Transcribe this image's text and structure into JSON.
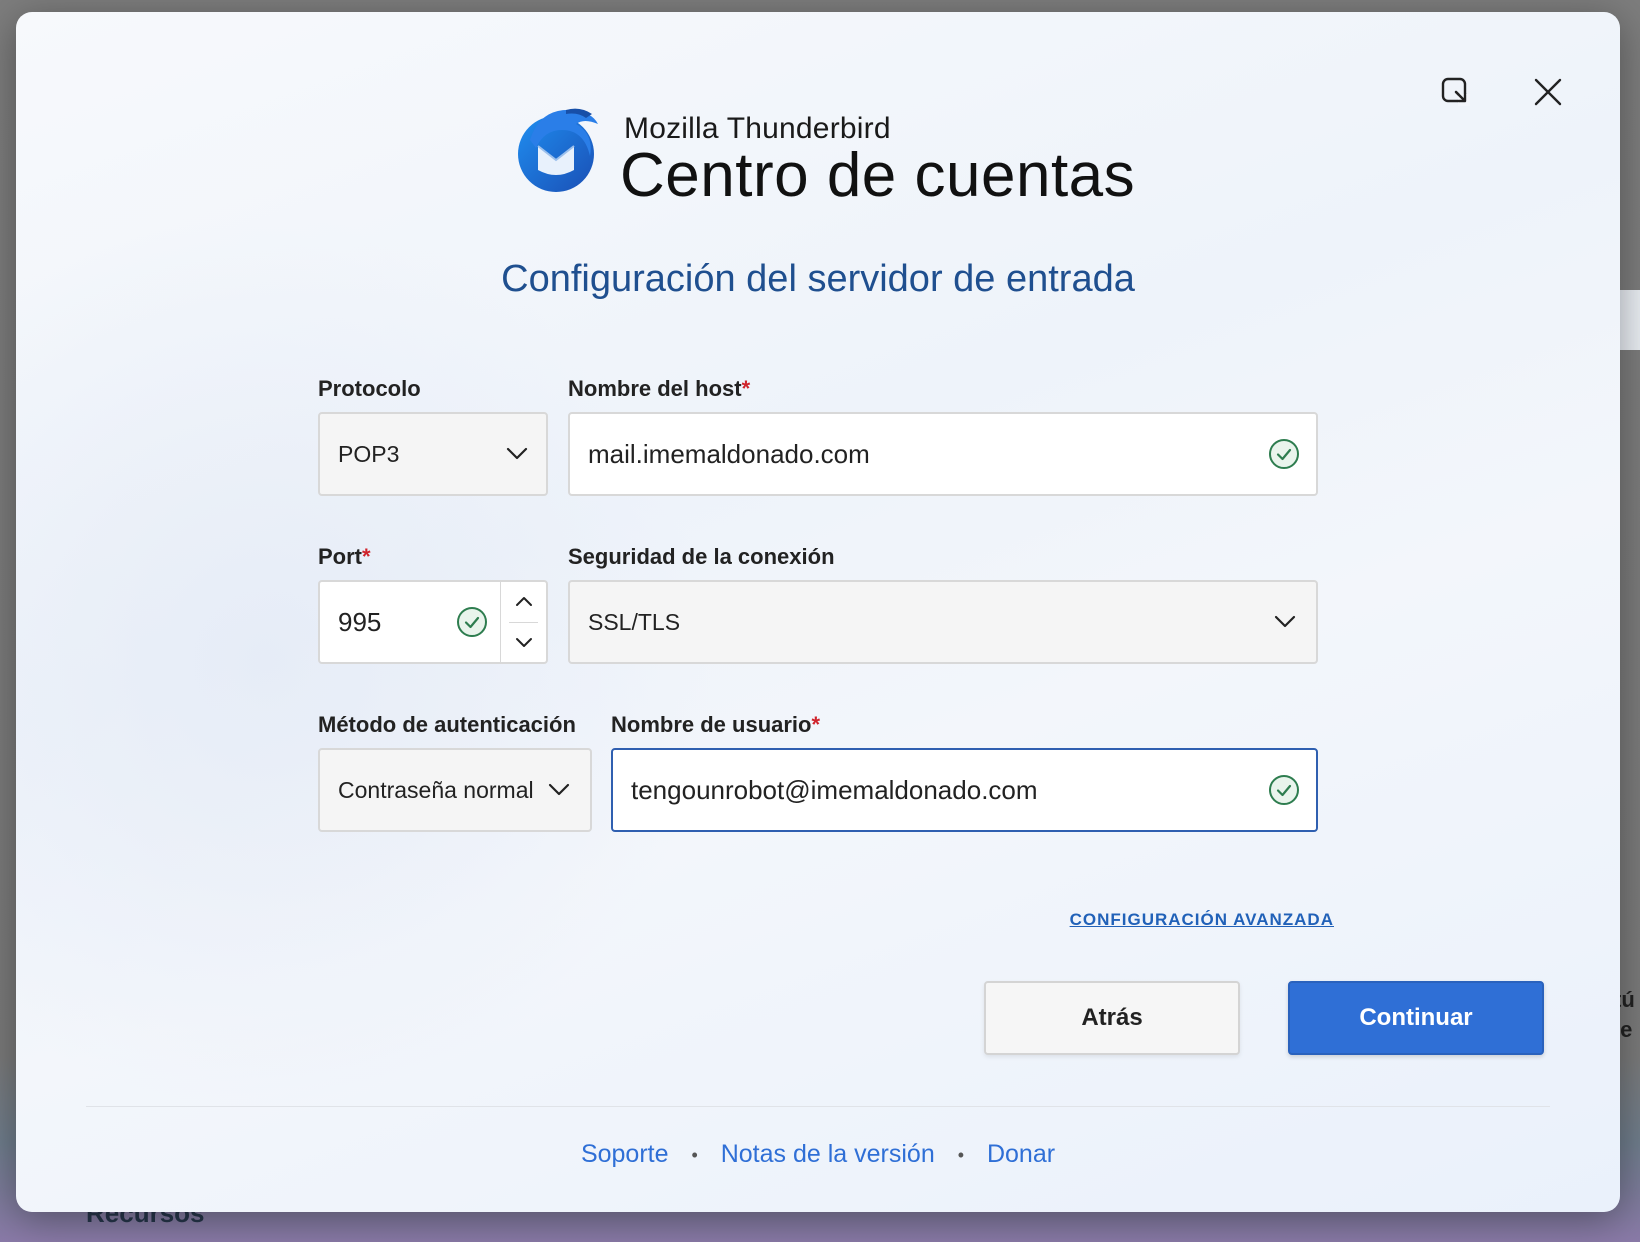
{
  "background": {
    "right_partial_text_top": "tú",
    "right_partial_text_bottom": "le",
    "bottom_partial_text": "Recursos"
  },
  "window": {
    "resize_icon": "resize-window-icon",
    "close_icon": "close-icon"
  },
  "brand": {
    "app_name": "Mozilla Thunderbird",
    "title": "Centro de cuentas",
    "logo_icon": "thunderbird-logo"
  },
  "page": {
    "title": "Configuración del servidor de entrada"
  },
  "form": {
    "protocol": {
      "label": "Protocolo",
      "value": "POP3"
    },
    "hostname": {
      "label": "Nombre del host",
      "required_mark": "*",
      "value": "mail.imemaldonado.com"
    },
    "port": {
      "label": "Port",
      "required_mark": "*",
      "value": "995"
    },
    "security": {
      "label": "Seguridad de la conexión",
      "value": "SSL/TLS"
    },
    "auth": {
      "label": "Método de autenticación",
      "value": "Contraseña normal"
    },
    "username": {
      "label": "Nombre de usuario",
      "required_mark": "*",
      "value": "tengounrobot@imemaldonado.com"
    },
    "advanced_link": "CONFIGURACIÓN AVANZADA"
  },
  "buttons": {
    "back": "Atrás",
    "continue": "Continuar"
  },
  "footer": {
    "support": "Soporte",
    "release_notes": "Notas de la versión",
    "donate": "Donar",
    "separator": "•"
  },
  "colors": {
    "accent": "#2f6fd6",
    "title": "#1f4f8f",
    "required": "#d0232b",
    "valid_check": "#2e7d4f"
  }
}
